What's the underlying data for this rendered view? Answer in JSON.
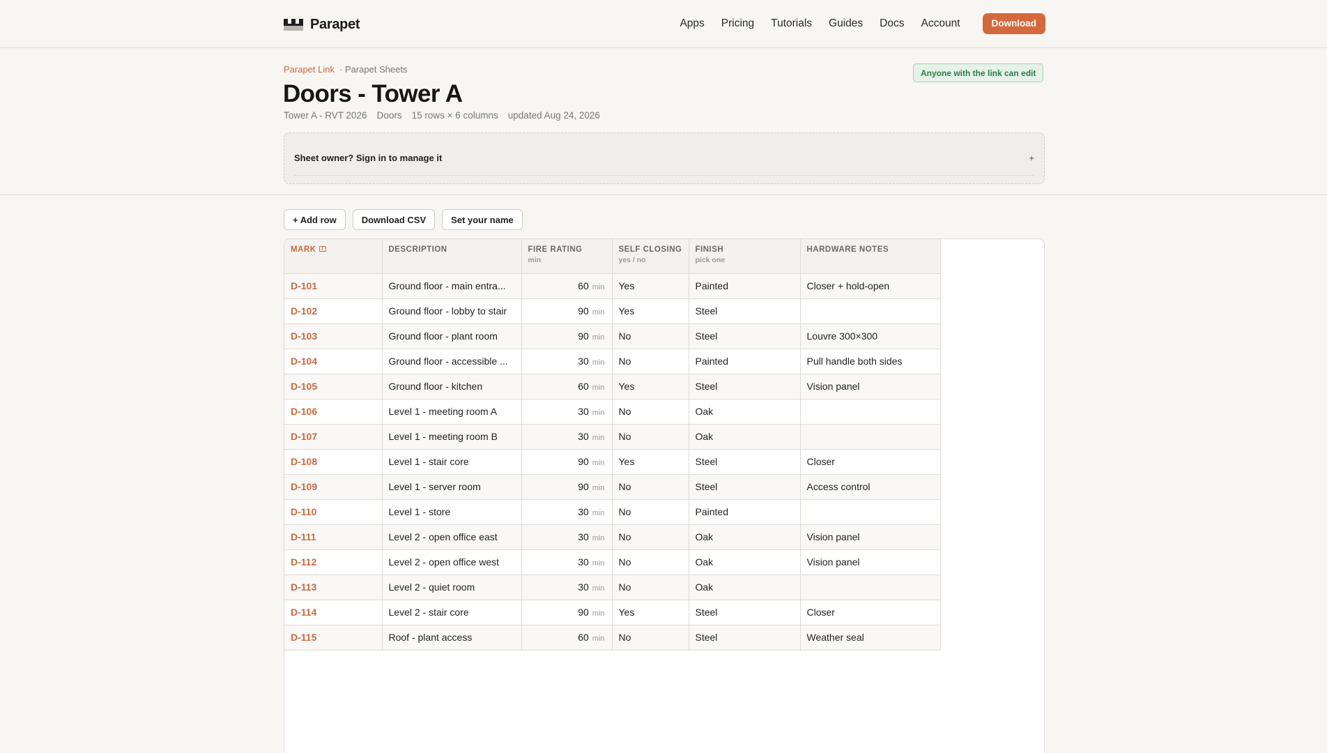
{
  "brand": {
    "name": "Parapet"
  },
  "nav": {
    "items": [
      "Apps",
      "Pricing",
      "Tutorials",
      "Guides",
      "Docs",
      "Account"
    ],
    "download_label": "Download"
  },
  "breadcrumb": {
    "link": "Parapet Link",
    "current": "· Parapet Sheets"
  },
  "share_badge": "Anyone with the link can edit",
  "title": "Doors - Tower A",
  "meta": {
    "project": "Tower A - RVT 2026",
    "category": "Doors",
    "size": "15 rows × 6 columns",
    "updated": "updated Aug 24, 2026"
  },
  "owner_prompt": {
    "text": "Sheet owner? Sign in to manage it",
    "expand": "+"
  },
  "toolbar": {
    "add_row": "+ Add row",
    "download_csv": "Download CSV",
    "set_name": "Set your name"
  },
  "table": {
    "columns": [
      {
        "label": "MARK",
        "sub": ""
      },
      {
        "label": "DESCRIPTION",
        "sub": ""
      },
      {
        "label": "FIRE RATING",
        "sub": "min"
      },
      {
        "label": "SELF CLOSING",
        "sub": "yes / no"
      },
      {
        "label": "FINISH",
        "sub": "pick one"
      },
      {
        "label": "HARDWARE NOTES",
        "sub": ""
      }
    ],
    "unit": "min",
    "rows": [
      {
        "mark": "D-101",
        "description": "Ground floor - main entra...",
        "fire": "60",
        "self_closing": "Yes",
        "finish": "Painted",
        "notes": "Closer + hold-open"
      },
      {
        "mark": "D-102",
        "description": "Ground floor - lobby to stair",
        "fire": "90",
        "self_closing": "Yes",
        "finish": "Steel",
        "notes": ""
      },
      {
        "mark": "D-103",
        "description": "Ground floor - plant room",
        "fire": "90",
        "self_closing": "No",
        "finish": "Steel",
        "notes": "Louvre 300×300"
      },
      {
        "mark": "D-104",
        "description": "Ground floor - accessible ...",
        "fire": "30",
        "self_closing": "No",
        "finish": "Painted",
        "notes": "Pull handle both sides"
      },
      {
        "mark": "D-105",
        "description": "Ground floor - kitchen",
        "fire": "60",
        "self_closing": "Yes",
        "finish": "Steel",
        "notes": "Vision panel"
      },
      {
        "mark": "D-106",
        "description": "Level 1 - meeting room A",
        "fire": "30",
        "self_closing": "No",
        "finish": "Oak",
        "notes": ""
      },
      {
        "mark": "D-107",
        "description": "Level 1 - meeting room B",
        "fire": "30",
        "self_closing": "No",
        "finish": "Oak",
        "notes": ""
      },
      {
        "mark": "D-108",
        "description": "Level 1 - stair core",
        "fire": "90",
        "self_closing": "Yes",
        "finish": "Steel",
        "notes": "Closer"
      },
      {
        "mark": "D-109",
        "description": "Level 1 - server room",
        "fire": "90",
        "self_closing": "No",
        "finish": "Steel",
        "notes": "Access control"
      },
      {
        "mark": "D-110",
        "description": "Level 1 - store",
        "fire": "30",
        "self_closing": "No",
        "finish": "Painted",
        "notes": ""
      },
      {
        "mark": "D-111",
        "description": "Level 2 - open office east",
        "fire": "30",
        "self_closing": "No",
        "finish": "Oak",
        "notes": "Vision panel"
      },
      {
        "mark": "D-112",
        "description": "Level 2 - open office west",
        "fire": "30",
        "self_closing": "No",
        "finish": "Oak",
        "notes": "Vision panel"
      },
      {
        "mark": "D-113",
        "description": "Level 2 - quiet room",
        "fire": "30",
        "self_closing": "No",
        "finish": "Oak",
        "notes": ""
      },
      {
        "mark": "D-114",
        "description": "Level 2 - stair core",
        "fire": "90",
        "self_closing": "Yes",
        "finish": "Steel",
        "notes": "Closer"
      },
      {
        "mark": "D-115",
        "description": "Roof - plant access",
        "fire": "60",
        "self_closing": "No",
        "finish": "Steel",
        "notes": "Weather seal"
      }
    ]
  },
  "colors": {
    "accent": "#d4693d",
    "mark_text": "#c96a3f",
    "badge_green": "#2f7a4a"
  }
}
